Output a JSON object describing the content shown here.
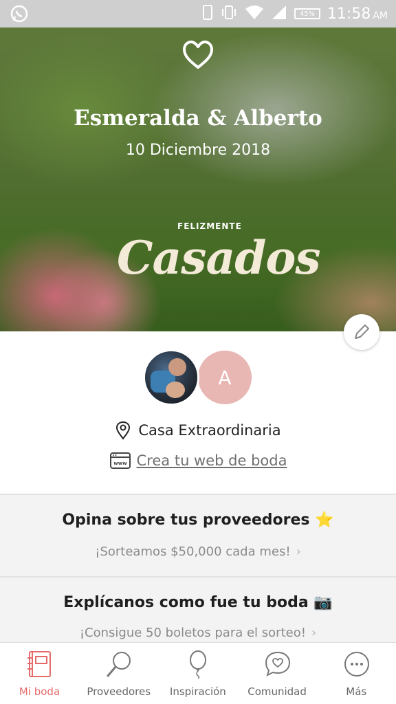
{
  "status_bar": {
    "battery": "45%",
    "time": "11:58",
    "ampm": "AM",
    "icons": [
      "whatsapp-icon",
      "phone-icon",
      "vibrate-icon",
      "wifi-icon",
      "signal-icon",
      "battery-icon"
    ]
  },
  "hero": {
    "names": "Esmeralda & Alberto",
    "date": "10 Diciembre 2018",
    "stamp_small": "FELIZMENTE",
    "stamp_big": "Casados",
    "edit_icon": "pencil-icon"
  },
  "couple": {
    "partner_initial": "A",
    "venue": "Casa Extraordinaria",
    "web_link": "Crea tu web de boda"
  },
  "promos": [
    {
      "title": "Opina sobre tus proveedores ⭐",
      "subtitle": "¡Sorteamos $50,000 cada mes!"
    },
    {
      "title": "Explícanos como fue tu boda 📷",
      "subtitle": "¡Consigue 50 boletos para el sorteo!"
    }
  ],
  "nav": [
    {
      "label": "Mi boda",
      "icon": "notebook-icon",
      "active": true
    },
    {
      "label": "Proveedores",
      "icon": "search-icon",
      "active": false
    },
    {
      "label": "Inspiración",
      "icon": "balloon-icon",
      "active": false
    },
    {
      "label": "Comunidad",
      "icon": "chat-heart-icon",
      "active": false
    },
    {
      "label": "Más",
      "icon": "more-icon",
      "active": false
    }
  ],
  "colors": {
    "accent": "#e56a6a",
    "status_bar": "#cfcfcf",
    "partner_avatar": "#e8b6b3",
    "card_bg": "#f3f3f3"
  }
}
